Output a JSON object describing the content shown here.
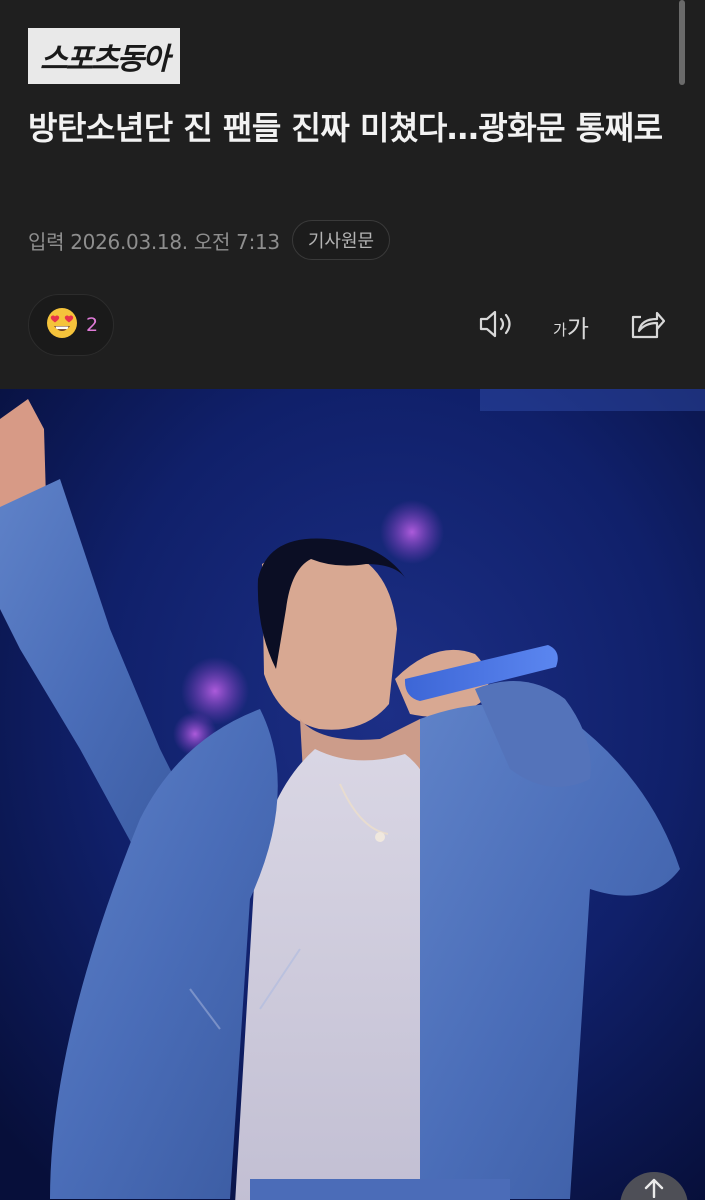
{
  "logo": {
    "text": "스포츠동아"
  },
  "article": {
    "title": "방탄소년단 진 팬들 진짜 미쳤다…광화문 통째로",
    "date_text": "입력 2026.03.18. 오전 7:13",
    "source_button_label": "기사원문"
  },
  "reaction": {
    "icon": "heart-eyes-emoji-icon",
    "count": "2"
  },
  "toolbar": {
    "speaker_icon": "speaker-icon",
    "font_size_small": "가",
    "font_size_large": "가",
    "share_icon": "share-icon"
  },
  "photo": {
    "icon": "article-photo"
  },
  "scroll_top": {
    "icon": "arrow-up-icon"
  },
  "colors": {
    "background": "#1f1f1f",
    "headline": "#f2f2f2",
    "meta_text": "#8e8e8e",
    "reaction_count": "#e07bd8",
    "photo_background": "#0d1a55"
  }
}
